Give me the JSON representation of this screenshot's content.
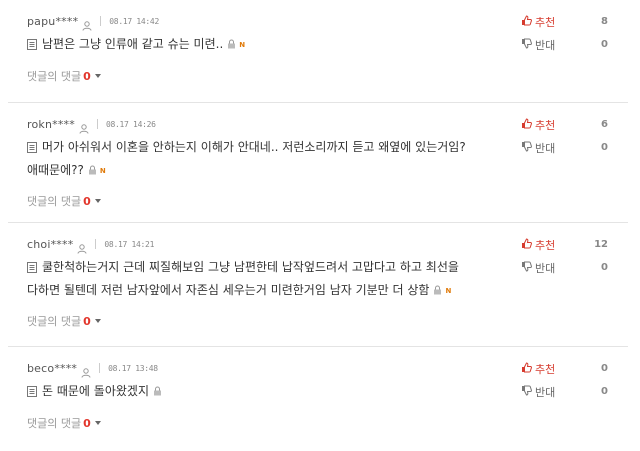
{
  "comments": [
    {
      "username": "papu****",
      "date": "08.17 14:42",
      "text_lines": [
        "남편은 그냥 인류애 같고 슈는 미련.."
      ],
      "has_new": true,
      "reply_label": "댓글의 댓글",
      "reply_count": "0",
      "up_label": "추천",
      "down_label": "반대",
      "up_count": "8",
      "down_count": "0"
    },
    {
      "username": "rokn****",
      "date": "08.17 14:26",
      "text_lines": [
        "머가 아쉬워서 이혼을 안하는지 이해가 안대네.. 저런소리까지 듣고 왜옆에 있는거임?",
        "애때문에??"
      ],
      "has_new": true,
      "reply_label": "댓글의 댓글",
      "reply_count": "0",
      "up_label": "추천",
      "down_label": "반대",
      "up_count": "6",
      "down_count": "0"
    },
    {
      "username": "choi****",
      "date": "08.17 14:21",
      "text_lines": [
        "쿨한척하는거지 근데 찌질해보임 그냥 남편한테 납작엎드려서 고맙다고 하고 최선을",
        "다하면 될텐데 저런 남자앞에서 자존심 세우는거 미련한거임 남자 기분만 더 상함"
      ],
      "has_new": true,
      "reply_label": "댓글의 댓글",
      "reply_count": "0",
      "up_label": "추천",
      "down_label": "반대",
      "up_count": "12",
      "down_count": "0"
    },
    {
      "username": "beco****",
      "date": "08.17 13:48",
      "text_lines": [
        "돈 때문에 돌아왔겠지"
      ],
      "has_new": false,
      "reply_label": "댓글의 댓글",
      "reply_count": "0",
      "up_label": "추천",
      "down_label": "반대",
      "up_count": "0",
      "down_count": "0"
    }
  ],
  "icons": {
    "user": "person-icon",
    "comment": "document-icon",
    "lock": "lock-icon",
    "new": "N",
    "recommend": "thumbs-up-icon",
    "oppose": "thumbs-down-icon",
    "expand": "caret-down-icon"
  },
  "colors": {
    "accent_red": "#e2352b",
    "recommend_red": "#d63b2e",
    "new_orange": "#e07a0a",
    "separator": "#e4e4e4"
  }
}
